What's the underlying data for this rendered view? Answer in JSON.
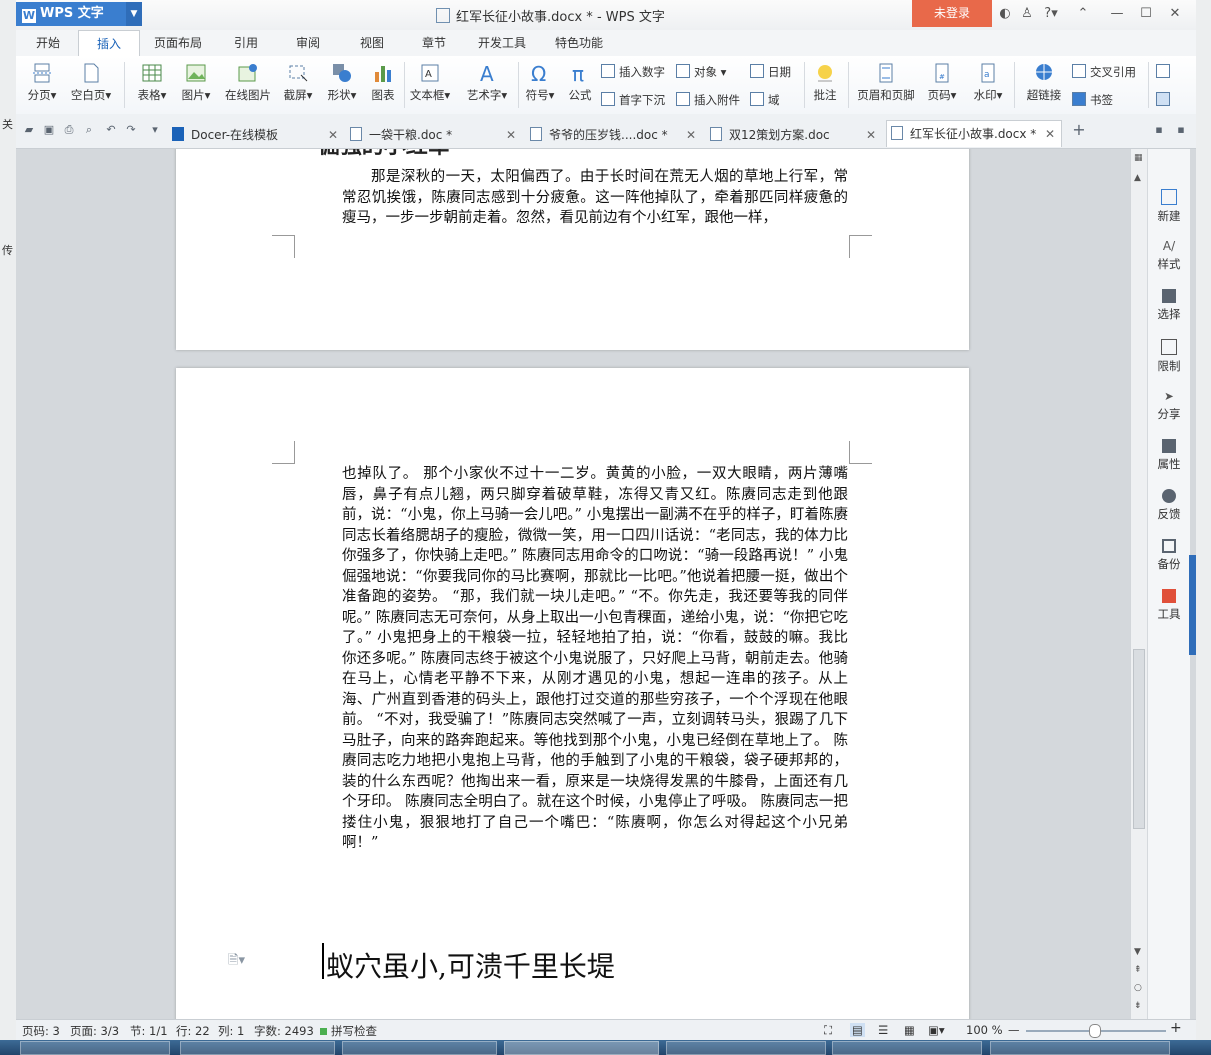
{
  "app": {
    "name": "WPS 文字",
    "doc_title": "红军长征小故事.docx * - WPS 文字",
    "login_label": "未登录",
    "help_label": "?"
  },
  "ribbon_tabs": [
    "开始",
    "插入",
    "页面布局",
    "引用",
    "审阅",
    "视图",
    "章节",
    "开发工具",
    "特色功能"
  ],
  "ribbon_active_tab": "插入",
  "ribbon": {
    "large_buttons": [
      "分页",
      "空白页",
      "表格",
      "图片",
      "在线图片",
      "截屏",
      "形状",
      "图表",
      "文本框",
      "艺术字",
      "符号",
      "公式",
      "批注",
      "页眉和页脚",
      "页码",
      "水印",
      "超链接"
    ],
    "small_buttons": [
      "插入数字",
      "对象",
      "日期",
      "首字下沉",
      "插入附件",
      "域",
      "交叉引用",
      "书签"
    ]
  },
  "doc_tabs": [
    {
      "label": "Docer-在线模板",
      "active": false
    },
    {
      "label": "一袋干粮.doc *",
      "active": false
    },
    {
      "label": "爷爷的压岁钱....doc *",
      "active": false
    },
    {
      "label": "双12策划方案.doc",
      "active": false
    },
    {
      "label": "红军长征小故事.docx *",
      "active": true
    }
  ],
  "document": {
    "page1_partial_heading": "• 倔强的小红军",
    "page1_text": "那是深秋的一天，太阳偏西了。由于长时间在荒无人烟的草地上行军，常常忍饥挨饿，陈赓同志感到十分疲惫。这一阵他掉队了，牵着那匹同样疲惫的瘦马，一步一步朝前走着。忽然，看见前边有个小红军，跟他一样，",
    "page2_text": "也掉队了。 那个小家伙不过十一二岁。黄黄的小脸，一双大眼睛，两片薄嘴唇，鼻子有点儿翘，两只脚穿着破草鞋，冻得又青又红。陈赓同志走到他跟前，说：“小鬼，你上马骑一会儿吧。” 小鬼摆出一副满不在乎的样子，盯着陈赓同志长着络腮胡子的瘦脸，微微一笑，用一口四川话说：“老同志，我的体力比你强多了，你快骑上走吧。” 陈赓同志用命令的口吻说：“骑一段路再说！” 小鬼倔强地说：“你要我同你的马比赛啊，那就比一比吧。”他说着把腰一挺，做出个准备跑的姿势。 “那，我们就一块儿走吧。” “不。你先走，我还要等我的同伴呢。” 陈赓同志无可奈何，从身上取出一小包青稞面，递给小鬼，说：“你把它吃了。” 小鬼把身上的干粮袋一拉，轻轻地拍了拍，说：“你看，鼓鼓的嘛。我比 你还多呢。” 陈赓同志终于被这个小鬼说服了，只好爬上马背，朝前走去。他骑在马上，心情老平静不下来，从刚才遇见的小鬼，想起一连串的孩子。从上海、广州直到香港的码头上，跟他打过交道的那些穷孩子，一个个浮现在他眼前。 “不对，我受骗了！”陈赓同志突然喊了一声，立刻调转马头，狠踢了几下马肚子，向来的路奔跑起来。等他找到那个小鬼，小鬼已经倒在草地上了。 陈赓同志吃力地把小鬼抱上马背，他的手触到了小鬼的干粮袋，袋子硬邦邦的，装的什么东西呢？他掏出来一看，原来是一块烧得发黑的牛膝骨，上面还有几个牙印。 陈赓同志全明白了。就在这个时候，小鬼停止了呼吸。 陈赓同志一把搂住小鬼，狠狠地打了自己一个嘴巴：“陈赓啊，你怎么对得起这个小兄弟啊！”",
    "heading_bottom": "蚁穴虽小,可溃千里长堤"
  },
  "right_panel": [
    "新建",
    "样式",
    "选择",
    "限制",
    "分享",
    "属性",
    "反馈",
    "备份",
    "工具"
  ],
  "status": {
    "page": "页码: 3",
    "pages": "页面: 3/3",
    "section": "节: 1/1",
    "row": "行: 22",
    "col": "列: 1",
    "words": "字数: 2493",
    "spell": "拼写检查",
    "zoom": "100 %"
  },
  "colors": {
    "accent": "#2f6db9",
    "login": "#e8694a"
  }
}
